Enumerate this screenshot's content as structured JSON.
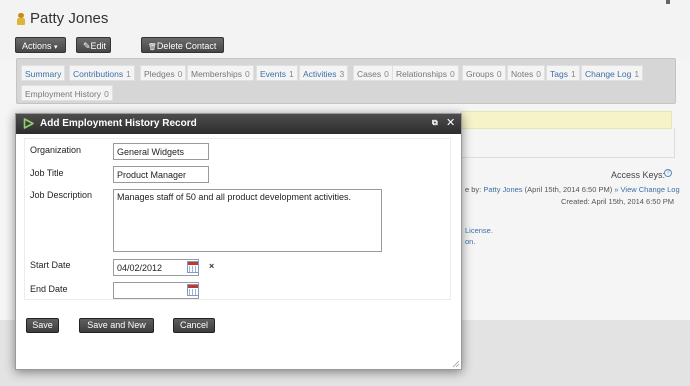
{
  "contact": {
    "name": "Patty Jones",
    "icon": "person-icon"
  },
  "toolbar": {
    "actions_label": "Actions",
    "actions_arrow": "▾",
    "edit_icon": "✎",
    "edit_label": "Edit",
    "delete_icon": "🗑",
    "delete_label": "Delete Contact"
  },
  "tabs": [
    {
      "label": "Summary",
      "count": "",
      "link": true
    },
    {
      "label": "Contributions",
      "count": "1",
      "link": true
    },
    {
      "label": "Pledges",
      "count": "0",
      "link": false
    },
    {
      "label": "Memberships",
      "count": "0",
      "link": false
    },
    {
      "label": "Events",
      "count": "1",
      "link": true
    },
    {
      "label": "Activities",
      "count": "3",
      "link": true
    },
    {
      "label": "Cases",
      "count": "0",
      "link": false
    },
    {
      "label": "Relationships",
      "count": "0",
      "link": false
    },
    {
      "label": "Groups",
      "count": "0",
      "link": false
    },
    {
      "label": "Notes",
      "count": "0",
      "link": false
    },
    {
      "label": "Tags",
      "count": "1",
      "link": true
    },
    {
      "label": "Change Log",
      "count": "1",
      "link": true
    },
    {
      "label": "Employment History",
      "count": "0",
      "link": false
    }
  ],
  "background": {
    "access_keys": "Access Keys:",
    "help": "?",
    "modified_prefix": "e by:",
    "modified_by": "Patty Jones",
    "modified_date": "(April 15th, 2014 6:50 PM)",
    "view_change_log": "» View Change Log",
    "created": "Created: April 15th, 2014 6:50 PM",
    "license_fragment": "License.",
    "on_fragment": "on."
  },
  "dialog": {
    "title": "Add Employment History Record",
    "restore_icon": "⧉",
    "close_icon": "✕",
    "form": {
      "organization_label": "Organization",
      "organization_value": "General Widgets",
      "job_title_label": "Job Title",
      "job_title_value": "Product Manager",
      "job_description_label": "Job Description",
      "job_description_value": "Manages staff of 50 and all product development activities.",
      "start_date_label": "Start Date",
      "start_date_value": "04/02/2012",
      "clear_label": "×",
      "end_date_label": "End Date",
      "end_date_value": ""
    },
    "buttons": {
      "save": "Save",
      "save_and_new": "Save and New",
      "cancel": "Cancel"
    }
  },
  "colors": {
    "link": "#3c6fa8",
    "dialog_title_bg": "#3a3a3a",
    "notice_bg": "#f6f3c9"
  }
}
